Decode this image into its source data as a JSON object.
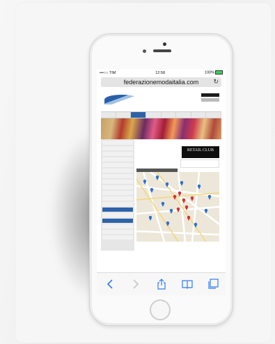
{
  "status_bar": {
    "carrier": "•••○○ TIM",
    "time": "12:58",
    "battery": "100%"
  },
  "browser": {
    "url": "federazionemodaitalia.com"
  },
  "site": {
    "logo_text": "",
    "nav_items": [
      "",
      "",
      "",
      "",
      "",
      "",
      "",
      ""
    ],
    "active_nav_index": 2,
    "sidebar_items": [
      "",
      "",
      "",
      "",
      "",
      "",
      "",
      "",
      "",
      "",
      "",
      "",
      "",
      "",
      "",
      "",
      "",
      ""
    ],
    "breadcrumb": "",
    "page_title": "",
    "retail_club": {
      "title": "RETAIL CLUB",
      "subtitle": ""
    },
    "fm_logo": "",
    "map_label": "",
    "footer_links": [
      "",
      "",
      "",
      ""
    ]
  },
  "icons": [
    "back-icon",
    "forward-icon",
    "share-icon",
    "bookmarks-icon",
    "tabs-icon",
    "reload-icon"
  ],
  "colors": {
    "brand_blue": "#2d62a8",
    "battery_green": "#3ad15a"
  }
}
